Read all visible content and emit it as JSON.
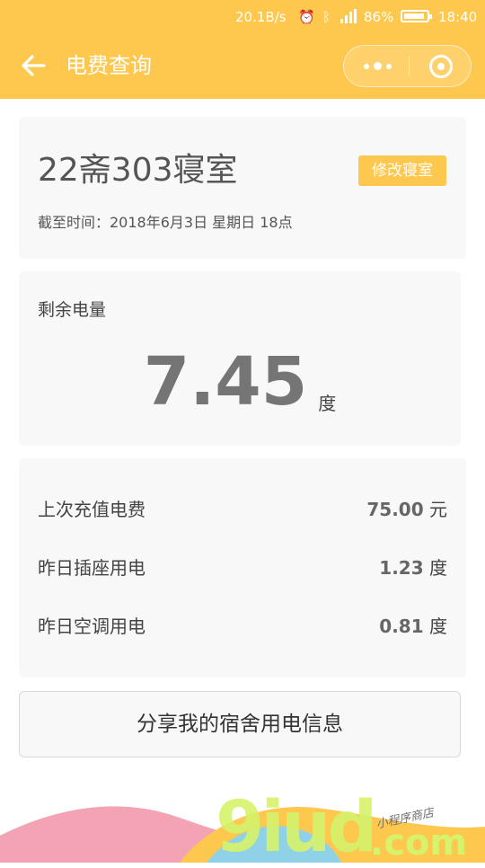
{
  "status_bar": {
    "speed": "20.1B/s",
    "battery_pct": "86%",
    "time": "18:40"
  },
  "nav": {
    "title": "电费查询"
  },
  "room_card": {
    "room_name": "22斋303寝室",
    "change_room_label": "修改寝室",
    "timestamp": "截至时间：2018年6月3日 星期日 18点"
  },
  "remaining": {
    "label": "剩余电量",
    "value": "7.45",
    "unit": "度"
  },
  "stats": [
    {
      "label": "上次充值电费",
      "value": "75.00",
      "unit": "元"
    },
    {
      "label": "昨日插座用电",
      "value": "1.23",
      "unit": "度"
    },
    {
      "label": "昨日空调用电",
      "value": "0.81",
      "unit": "度"
    }
  ],
  "share_button": {
    "label": "分享我的宿舍用电信息"
  },
  "watermark": {
    "main": "9iud",
    "suffix": ".com",
    "small": "小程序商店"
  },
  "colors": {
    "accent": "#fec74e",
    "card_bg": "#f8f8f8",
    "value_text": "#757575"
  }
}
